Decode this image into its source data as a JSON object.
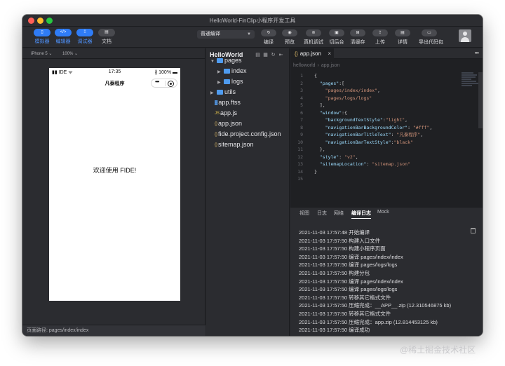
{
  "window": {
    "title": "HelloWorld-FinClip小程序开发工具"
  },
  "toolbar": {
    "left_buttons": [
      {
        "icon": "phone-icon",
        "glyph": "▯",
        "label": "模拟器",
        "active": true
      },
      {
        "icon": "code-icon",
        "glyph": "</>",
        "label": "编辑器",
        "active": true
      },
      {
        "icon": "debug-icon",
        "glyph": "⁞⁞",
        "label": "调试器",
        "active": true
      },
      {
        "icon": "doc-icon",
        "glyph": "▤",
        "label": "文档",
        "active": false
      }
    ],
    "compile_mode": "普通编译",
    "right_buttons": [
      {
        "icon": "refresh-icon",
        "glyph": "↻",
        "label": "编译"
      },
      {
        "icon": "eye-icon",
        "glyph": "◉",
        "label": "预览"
      },
      {
        "icon": "device-debug-icon",
        "glyph": "⊚",
        "label": "真机调试"
      },
      {
        "icon": "background-icon",
        "glyph": "▣",
        "label": "切后台"
      },
      {
        "icon": "cache-icon",
        "glyph": "⊞",
        "label": "清缓存"
      },
      {
        "icon": "upload-icon",
        "glyph": "⇪",
        "label": "上传"
      },
      {
        "icon": "details-icon",
        "glyph": "▤",
        "label": "详情"
      },
      {
        "icon": "folder-icon",
        "glyph": "▭",
        "label": "导出代码包"
      }
    ]
  },
  "simulator": {
    "device": "iPhone 5 ⌄",
    "zoom": "100% ⌄",
    "status": {
      "carrier": "▮▮ IDE ᯤ",
      "time": "17:35",
      "battery": "∦ 100% ▬"
    },
    "nav_title": "凡泰程序",
    "capsule_more": "•••",
    "welcome": "欢迎使用 FIDE!",
    "footer_path": "页面路径: pages/index/index"
  },
  "explorer": {
    "title": "HelloWorld",
    "header_icons": [
      "▤",
      "▦",
      "↻",
      "⇤"
    ],
    "items": [
      {
        "label": "pages",
        "type": "folder",
        "expanded": true,
        "depth": 0
      },
      {
        "label": "index",
        "type": "folder",
        "expanded": false,
        "depth": 1
      },
      {
        "label": "logs",
        "type": "folder",
        "expanded": false,
        "depth": 1
      },
      {
        "label": "utils",
        "type": "folder",
        "expanded": false,
        "depth": 0
      },
      {
        "label": "app.ftss",
        "type": "css",
        "glyph": "▓",
        "color": "#5aa8ff",
        "depth": 0
      },
      {
        "label": "app.js",
        "type": "js",
        "glyph": "JS",
        "color": "#e8c64d",
        "depth": 0
      },
      {
        "label": "app.json",
        "type": "json",
        "glyph": "{}",
        "color": "#e6c06a",
        "depth": 0,
        "selected": true
      },
      {
        "label": "fide.project.config.json",
        "type": "json",
        "glyph": "{}",
        "color": "#e6c06a",
        "depth": 0
      },
      {
        "label": "sitemap.json",
        "type": "json",
        "glyph": "{}",
        "color": "#e6c06a",
        "depth": 0
      }
    ]
  },
  "editor": {
    "tab": {
      "icon": "{}",
      "label": "app.json",
      "close": "×"
    },
    "more": "•••",
    "breadcrumb": [
      "helloworld",
      "app.json"
    ],
    "lines": [
      {
        "n": "1",
        "t": "{"
      },
      {
        "n": "2",
        "t": "  \"pages\":["
      },
      {
        "n": "3",
        "t": "    \"pages/index/index\","
      },
      {
        "n": "4",
        "t": "    \"pages/logs/logs\""
      },
      {
        "n": "5",
        "t": "  ],"
      },
      {
        "n": "6",
        "t": "  \"window\":{"
      },
      {
        "n": "7",
        "t": "    \"backgroundTextStyle\":\"light\","
      },
      {
        "n": "8",
        "t": "    \"navigationBarBackgroundColor\": \"#fff\","
      },
      {
        "n": "9",
        "t": "    \"navigationBarTitleText\": \"凡泰程序\","
      },
      {
        "n": "10",
        "t": "    \"navigationBarTextStyle\":\"black\""
      },
      {
        "n": "11",
        "t": "  },"
      },
      {
        "n": "12",
        "t": "  \"style\": \"v2\","
      },
      {
        "n": "13",
        "t": "  \"sitemapLocation\": \"sitemap.json\""
      },
      {
        "n": "14",
        "t": "}"
      },
      {
        "n": "15",
        "t": ""
      }
    ]
  },
  "console": {
    "tabs": [
      "视图",
      "日志",
      "网络",
      "编译日志",
      "Mock"
    ],
    "active_tab": 3,
    "logs": [
      "2021-11-03 17:57:48 开始编译",
      "2021-11-03 17:57:50 构建入口文件",
      "2021-11-03 17:57:50 构建小程序页面",
      "2021-11-03 17:57:50 编译 pages/index/index",
      "2021-11-03 17:57:50 编译 pages/logs/logs",
      "2021-11-03 17:57:50 构建分包",
      "2021-11-03 17:57:50 编译 pages/index/index",
      "2021-11-03 17:57:50 编译 pages/logs/logs",
      "2021-11-03 17:57:50 转移其它格式文件",
      "2021-11-03 17:57:50 压缩完成：__APP__.zip (12.310546875 kb)",
      "2021-11-03 17:57:50 转移其它格式文件",
      "2021-11-03 17:57:50 压缩完成：app.zip (12.814453125 kb)",
      "2021-11-03 17:57:50 编译成功"
    ]
  },
  "watermark": "@稀土掘金技术社区",
  "colors": {
    "accent": "#2f7cf6",
    "folder": "#4f9cf0",
    "json_icon": "#e6c06a"
  }
}
